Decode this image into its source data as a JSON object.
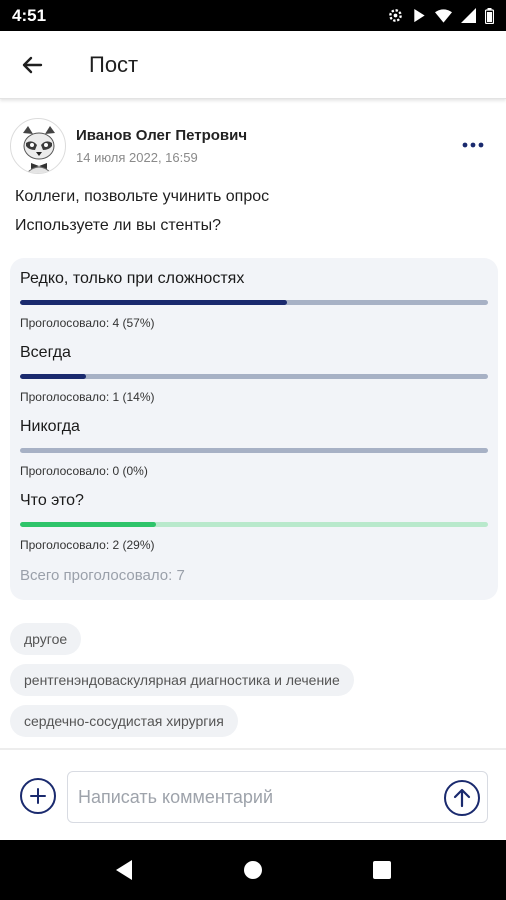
{
  "status_bar": {
    "time": "4:51"
  },
  "header": {
    "title": "Пост"
  },
  "post": {
    "author": "Иванов Олег Петрович",
    "date": "14 июля 2022, 16:59",
    "text_lines": [
      "Коллеги, позвольте учинить опрос",
      "Используете ли вы стенты?"
    ]
  },
  "poll": {
    "options": [
      {
        "label": "Редко, только при сложностях",
        "votes": "Проголосовало: 4 (57%)",
        "fraction": 0.57,
        "color": "#1a2a6e",
        "track": "#a7b1c5"
      },
      {
        "label": "Всегда",
        "votes": "Проголосовало: 1 (14%)",
        "fraction": 0.14,
        "color": "#1a2a6e",
        "track": "#a7b1c5"
      },
      {
        "label": "Никогда",
        "votes": "Проголосовало: 0 (0%)",
        "fraction": 0.0,
        "color": "#1a2a6e",
        "track": "#a7b1c5"
      },
      {
        "label": "Что это?",
        "votes": "Проголосовало: 2 (29%)",
        "fraction": 0.29,
        "color": "#2ec46a",
        "track": "#b9e9cc"
      }
    ],
    "total": "Всего проголосовало: 7"
  },
  "tags": [
    "другое",
    "рентгенэндоваскулярная диагностика и лечение",
    "сердечно-сосудистая хирургия"
  ],
  "comment": {
    "placeholder": "Написать комментарий"
  },
  "colors": {
    "accent": "#1a2a6e",
    "green": "#2ec46a"
  },
  "icons": {
    "back": "arrow-left-icon",
    "more": "more-horizontal-icon",
    "add": "plus-circle-icon",
    "send": "arrow-up-circle-icon"
  }
}
